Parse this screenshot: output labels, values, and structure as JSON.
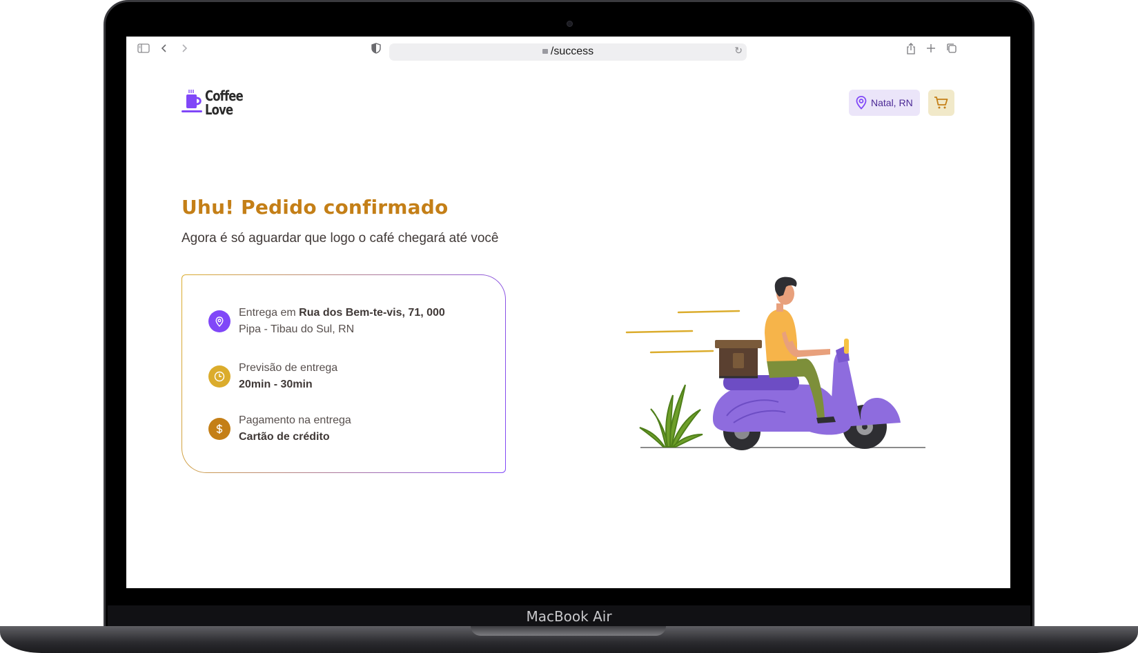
{
  "browser": {
    "url": "/success"
  },
  "device": {
    "label": "MacBook Air"
  },
  "header": {
    "logo_line1": "Coffee",
    "logo_line2": "Love",
    "location": "Natal, RN"
  },
  "main": {
    "title": "Uhu! Pedido confirmado",
    "subtitle": "Agora é só aguardar que logo o café chegará até você",
    "delivery": {
      "prefix": "Entrega em ",
      "address": "Rua dos Bem-te-vis, 71, 000",
      "district": "Pipa - Tibau do Sul, RN"
    },
    "eta": {
      "label": "Previsão de entrega",
      "value": "20min - 30min"
    },
    "payment": {
      "label": "Pagamento na entrega",
      "value": "Cartão de crédito"
    }
  },
  "colors": {
    "purple": "#8047f8",
    "yellow": "#dbac2c",
    "yellow_dark": "#c47f17",
    "text": "#403937"
  }
}
